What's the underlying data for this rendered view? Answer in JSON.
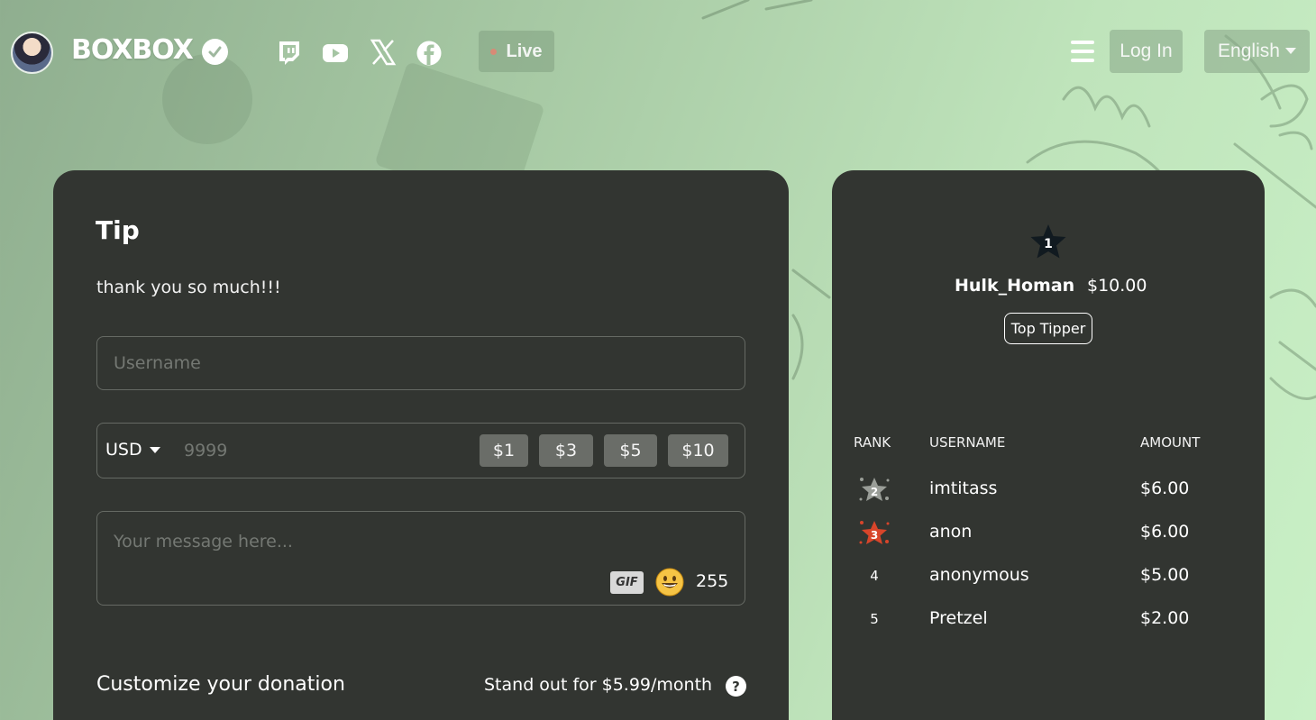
{
  "header": {
    "brand": "BOXBOX",
    "live_label": "Live",
    "login_label": "Log In",
    "language_label": "English",
    "social": [
      "twitch-icon",
      "youtube-icon",
      "x-icon",
      "facebook-icon"
    ]
  },
  "tip": {
    "title": "Tip",
    "message": "thank you so much!!!",
    "username_placeholder": "Username",
    "currency": "USD",
    "amount_placeholder": "9999",
    "presets": [
      "$1",
      "$3",
      "$5",
      "$10"
    ],
    "message_placeholder": "Your message here...",
    "gif_label": "GIF",
    "char_count": "255",
    "customize_label": "Customize your donation",
    "standout_label": "Stand out for $5.99/month",
    "help_label": "?"
  },
  "leaderboard": {
    "top": {
      "rank": "1",
      "username": "Hulk_Homan",
      "amount": "$10.00",
      "badge": "Top Tipper"
    },
    "headers": {
      "rank": "RANK",
      "username": "USERNAME",
      "amount": "AMOUNT"
    },
    "rows": [
      {
        "rank": "2",
        "username": "imtitass",
        "amount": "$6.00"
      },
      {
        "rank": "3",
        "username": "anon",
        "amount": "$6.00"
      },
      {
        "rank": "4",
        "username": "anonymous",
        "amount": "$5.00"
      },
      {
        "rank": "5",
        "username": "Pretzel",
        "amount": "$2.00"
      }
    ]
  },
  "colors": {
    "panel": "#323531",
    "rank2_star": "#9a9e98",
    "rank3_star": "#d8452a",
    "rank1_star": "#111a20"
  }
}
